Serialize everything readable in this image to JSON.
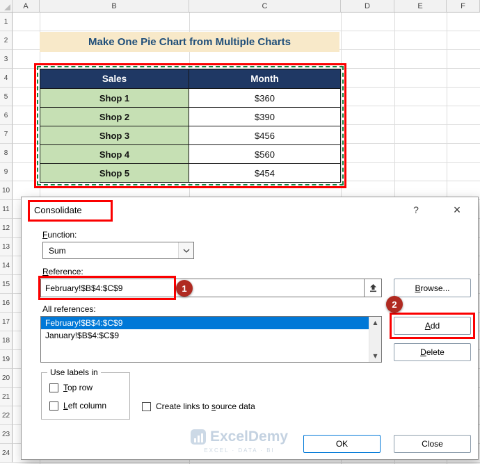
{
  "sheet": {
    "col_headers": [
      "A",
      "B",
      "C",
      "D",
      "E",
      "F"
    ],
    "row_headers": [
      "1",
      "2",
      "3",
      "4",
      "5",
      "6",
      "7",
      "8",
      "9",
      "10",
      "11",
      "12",
      "13",
      "14",
      "15",
      "16",
      "17",
      "18",
      "19",
      "20",
      "21",
      "22",
      "23",
      "24"
    ],
    "title": "Make One Pie Chart from Multiple Charts",
    "table": {
      "col1_header": "Sales",
      "col2_header": "Month",
      "rows": [
        [
          "Shop 1",
          "$360"
        ],
        [
          "Shop 2",
          "$390"
        ],
        [
          "Shop 3",
          "$456"
        ],
        [
          "Shop 4",
          "$560"
        ],
        [
          "Shop 5",
          "$454"
        ]
      ]
    }
  },
  "dialog": {
    "title": "Consolidate",
    "help_glyph": "?",
    "close_glyph": "×",
    "function_label": "Function:",
    "function_value": "Sum",
    "reference_label": "Reference:",
    "reference_value": "February!$B$4:$C$9",
    "browse": "Browse...",
    "all_references_label": "All references:",
    "references": [
      "February!$B$4:$C$9",
      "January!$B$4:$C$9"
    ],
    "add": "Add",
    "delete": "Delete",
    "use_labels": "Use labels in",
    "top_row": "Top row",
    "left_column": "Left column",
    "create_links": "Create links to source data",
    "ok": "OK",
    "close_button": "Close",
    "scroll_up": "▲",
    "scroll_down": "▼"
  },
  "annotations": {
    "step1": "1",
    "step2": "2"
  },
  "watermark": {
    "name": "ExcelDemy",
    "tagline": "EXCEL · DATA · BI"
  },
  "colors": {
    "table_header_bg": "#1f3864",
    "shop_cell_bg": "#c6e0b4",
    "title_band_bg": "#f8e9c9",
    "title_text": "#1f4e79",
    "annotation_red": "#fb0000",
    "selection_blue": "#0078d7",
    "ants_green": "#12813f",
    "badge_red": "#b02a21"
  }
}
